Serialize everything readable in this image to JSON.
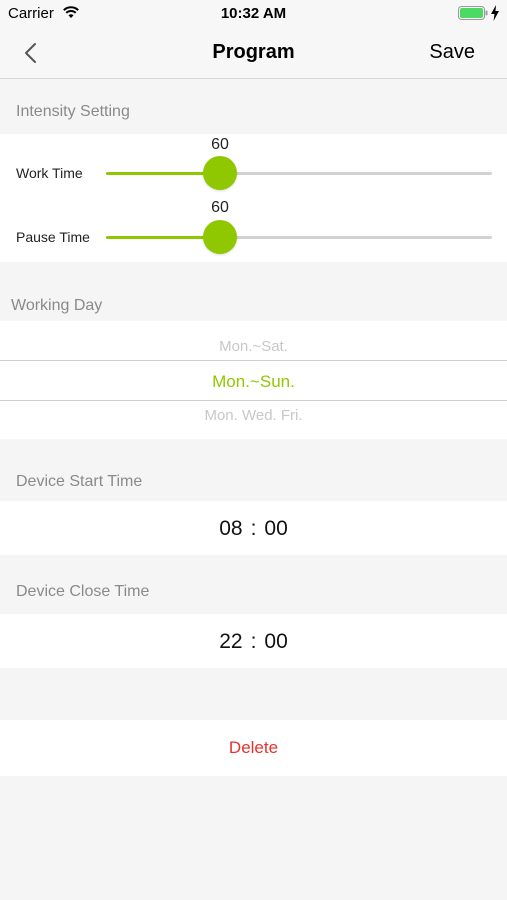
{
  "status_bar": {
    "carrier": "Carrier",
    "time": "10:32 AM"
  },
  "nav": {
    "title": "Program",
    "save_label": "Save",
    "back_icon": "chevron-left-icon"
  },
  "intensity": {
    "header": "Intensity Setting",
    "work_time": {
      "label": "Work Time",
      "value": "60"
    },
    "pause_time": {
      "label": "Pause Time",
      "value": "60"
    }
  },
  "working_day": {
    "header": "Working Day",
    "options": [
      "Mon.~Sat.",
      "Mon.~Sun.",
      "Mon. Wed. Fri."
    ],
    "selected": "Mon.~Sun."
  },
  "start_time": {
    "header": "Device Start Time",
    "hour": "08",
    "minute": "00"
  },
  "close_time": {
    "header": "Device Close Time",
    "hour": "22",
    "minute": "00"
  },
  "delete_label": "Delete",
  "colors": {
    "accent": "#8fc700",
    "delete": "#e8312f"
  }
}
